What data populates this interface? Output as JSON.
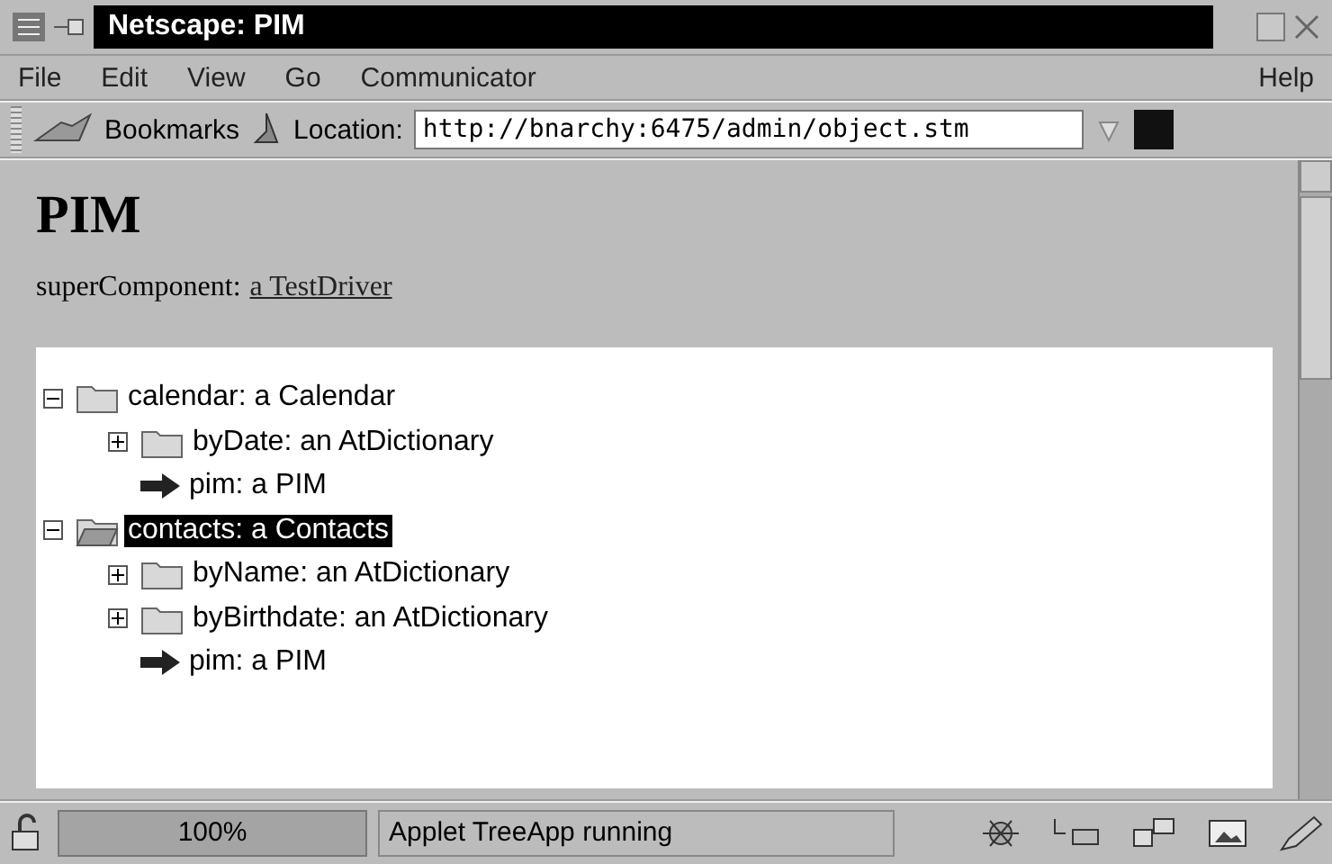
{
  "window": {
    "title": "Netscape: PIM"
  },
  "menu": [
    "File",
    "Edit",
    "View",
    "Go",
    "Communicator"
  ],
  "help_menu": "Help",
  "toolbar": {
    "bookmarks": "Bookmarks",
    "location_label": "Location:",
    "url": "http://bnarchy:6475/admin/object.stm"
  },
  "page": {
    "heading": "PIM",
    "label": "superComponent:",
    "link": "a TestDriver"
  },
  "tree": [
    {
      "kind": "folder",
      "label": "calendar: a Calendar",
      "expanded": true,
      "selected": false,
      "children": [
        {
          "kind": "folder",
          "label": "byDate: an AtDictionary",
          "expanded": false,
          "selected": false
        },
        {
          "kind": "reference",
          "label": "pim: a PIM",
          "selected": false
        }
      ]
    },
    {
      "kind": "folder",
      "label": "contacts: a Contacts",
      "expanded": true,
      "selected": true,
      "children": [
        {
          "kind": "folder",
          "label": "byName: an AtDictionary",
          "expanded": false,
          "selected": false
        },
        {
          "kind": "folder",
          "label": "byBirthdate: an AtDictionary",
          "expanded": false,
          "selected": false
        },
        {
          "kind": "reference",
          "label": "pim: a PIM",
          "selected": false
        }
      ]
    }
  ],
  "status_bar": {
    "progress": "100%",
    "level": 1,
    "message": "Applet TreeApp running"
  }
}
